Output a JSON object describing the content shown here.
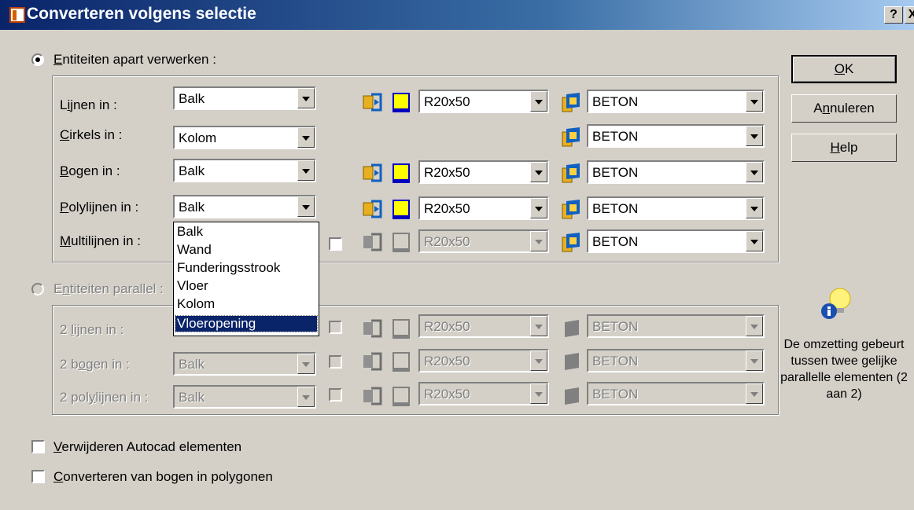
{
  "window": {
    "title": "Converteren volgens selectie",
    "help_glyph": "?",
    "close_glyph": "X"
  },
  "mode1": {
    "label_u": "E",
    "label_rest": "ntiteiten apart verwerken :"
  },
  "mode2": {
    "label_a": "E",
    "label_u": "n",
    "label_rest": "titeiten parallel :"
  },
  "rows1": [
    {
      "l1": "L",
      "l2": "i",
      "l3": "jnen in :",
      "elem": "Balk",
      "profile": "R20x50",
      "material": "BETON"
    },
    {
      "l1": "",
      "l2": "C",
      "l3": "irkels in :",
      "elem": "Kolom",
      "material": "BETON"
    },
    {
      "l1": "",
      "l2": "B",
      "l3": "ogen in :",
      "elem": "Balk",
      "profile": "R20x50",
      "material": "BETON"
    },
    {
      "l1": "",
      "l2": "P",
      "l3": "olylijnen in :",
      "elem": "Balk",
      "profile": "R20x50",
      "material": "BETON"
    },
    {
      "l1": "",
      "l2": "M",
      "l3": "ultilijnen in :",
      "profile": "R20x50",
      "material": "BETON"
    }
  ],
  "rows2": [
    {
      "l1": "2 ",
      "l2": "l",
      "l3": "ijnen in :",
      "profile": "R20x50",
      "material": "BETON"
    },
    {
      "l1": "2 b",
      "l2": "o",
      "l3": "gen in :",
      "elem": "Balk",
      "profile": "R20x50",
      "material": "BETON"
    },
    {
      "l1": "2 pol",
      "l2": "y",
      "l3": "lijnen in :",
      "elem": "Balk",
      "profile": "R20x50",
      "material": "BETON"
    }
  ],
  "dropdown": {
    "options": [
      "Balk",
      "Wand",
      "Funderingsstrook",
      "Vloer",
      "Kolom",
      "Vloeropening"
    ],
    "selected": "Vloeropening"
  },
  "checks": {
    "delete_u": "V",
    "delete_rest": "erwijderen Autocad elementen",
    "convert_u": "C",
    "convert_rest": "onverteren van bogen in polygonen"
  },
  "buttons": {
    "ok_u": "O",
    "ok_rest": "K",
    "cancel_a": "A",
    "cancel_u": "n",
    "cancel_rest": "nuleren",
    "help_u": "H",
    "help_rest": "elp"
  },
  "info_text": "De omzetting gebeurt tussen twee gelijke parallelle elementen (2 aan 2)",
  "icons": [
    "profile-edit-icon",
    "profile-yellow-icon",
    "material-icon",
    "info-bulb-icon"
  ],
  "colors": {
    "title_start": "#0a246a",
    "title_end": "#a6caf0",
    "face": "#d4d0c8",
    "selection": "#0a246a"
  }
}
